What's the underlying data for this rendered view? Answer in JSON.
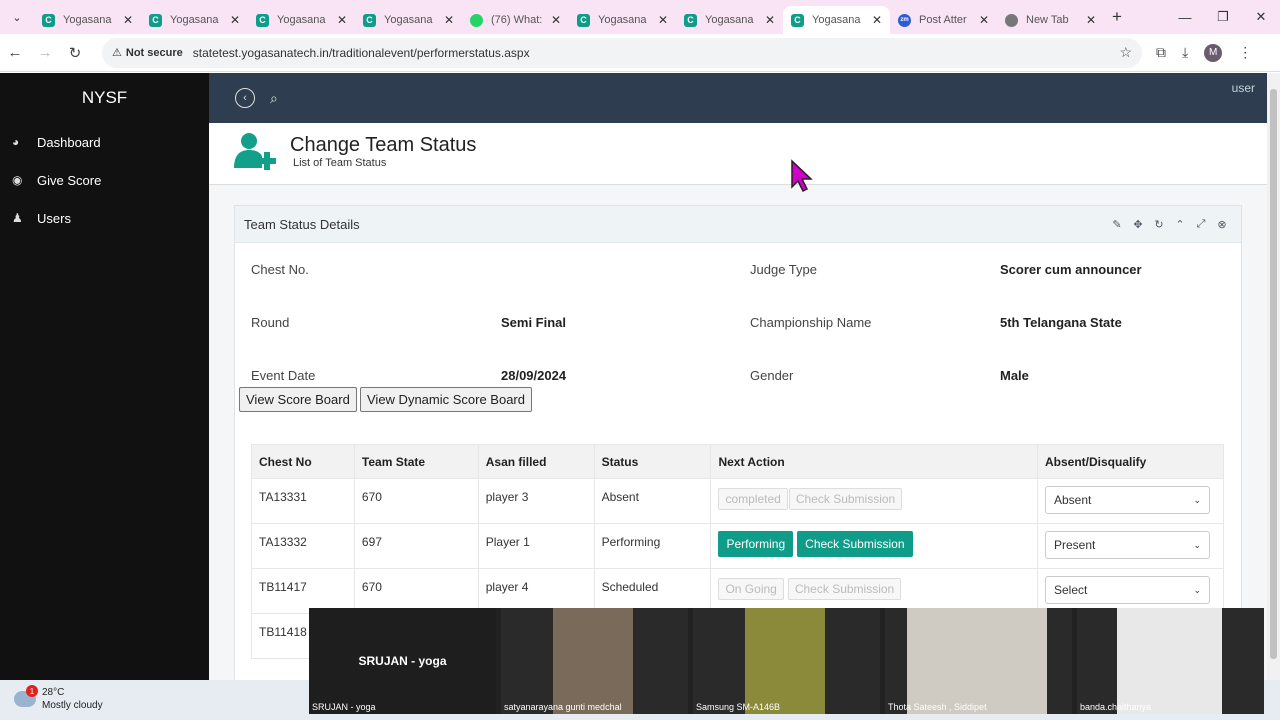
{
  "browser": {
    "tabs": [
      {
        "title": "Yogasana",
        "favicon": "C"
      },
      {
        "title": "Yogasana",
        "favicon": "C"
      },
      {
        "title": "Yogasana",
        "favicon": "C"
      },
      {
        "title": "Yogasana",
        "favicon": "C"
      },
      {
        "title": "(76) What:",
        "favicon": "wa"
      },
      {
        "title": "Yogasana",
        "favicon": "C"
      },
      {
        "title": "Yogasana",
        "favicon": "C"
      },
      {
        "title": "Yogasana",
        "favicon": "C"
      },
      {
        "title": "Post Atter",
        "favicon": "zm"
      },
      {
        "title": "New Tab",
        "favicon": "nt"
      }
    ],
    "not_secure": "Not secure",
    "url": "statetest.yogasanatech.in/traditionalevent/performerstatus.aspx",
    "profile_initial": "M"
  },
  "sidebar": {
    "brand": "NYSF",
    "items": [
      {
        "label": "Dashboard",
        "icon": "dashboard-icon"
      },
      {
        "label": "Give Score",
        "icon": "palette-icon"
      },
      {
        "label": "Users",
        "icon": "user-icon"
      }
    ]
  },
  "topbar": {
    "user_alt": "user"
  },
  "header": {
    "title": "Change Team Status",
    "subtitle": "List of Team Status"
  },
  "panel": {
    "title": "Team Status Details",
    "fields": {
      "chest_no_label": "Chest No.",
      "judge_type_label": "Judge Type",
      "judge_type_value": "Scorer cum announcer",
      "round_label": "Round",
      "round_value": "Semi Final",
      "championship_label": "Championship Name",
      "championship_value": "5th Telangana State",
      "event_date_label": "Event Date",
      "event_date_value": "28/09/2024",
      "gender_label": "Gender",
      "gender_value": "Male"
    },
    "buttons": {
      "score_board": "View Score Board",
      "dynamic_score_board": "View Dynamic Score Board"
    }
  },
  "table": {
    "headers": [
      "Chest No",
      "Team State",
      "Asan filled",
      "Status",
      "Next Action",
      "Absent/Disqualify"
    ],
    "rows": [
      {
        "chest": "TA13331",
        "state": "670",
        "asan": "player 3",
        "status": "Absent",
        "action1": "completed",
        "action2": "Check Submission",
        "select": "Absent"
      },
      {
        "chest": "TA13332",
        "state": "697",
        "asan": "Player 1",
        "status": "Performing",
        "action1": "Performing",
        "action2": "Check Submission",
        "select": "Present"
      },
      {
        "chest": "TB11417",
        "state": "670",
        "asan": "player 4",
        "status": "Scheduled",
        "action1": "On Going",
        "action2": "Check Submission",
        "select": "Select"
      },
      {
        "chest": "TB11418"
      }
    ]
  },
  "video_tiles": [
    {
      "name": "SRUJAN - yoga",
      "center": "SRUJAN - yoga"
    },
    {
      "name": "satyanarayana gunti medchal"
    },
    {
      "name": "Samsung SM-A146B"
    },
    {
      "name": "Thota Sateesh , Siddipet"
    },
    {
      "name": "banda.chaithanya"
    }
  ],
  "taskbar": {
    "temperature": "28°C",
    "weather": "Mostly cloudy",
    "badge": "1"
  }
}
